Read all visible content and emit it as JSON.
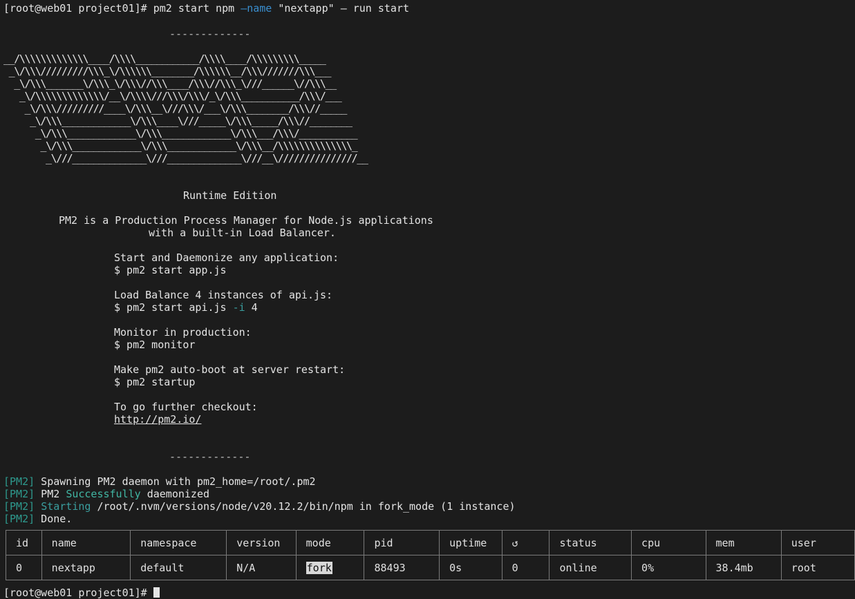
{
  "terminal": {
    "prompt": "[root@web01 project01]# ",
    "command": {
      "part1": "pm2 start npm ",
      "flag": "—name",
      "part2": " \"nextapp\" ",
      "part3": "— run start"
    },
    "separator": "-------------",
    "ascii_art": [
      "__/\\\\\\\\\\\\\\\\\\\\\\\\\\____/\\\\\\\\____________/\\\\\\\\____/\\\\\\\\\\\\\\\\\\_____",
      " _\\/\\\\\\/////////\\\\\\_\\/\\\\\\\\\\\\________/\\\\\\\\\\\\__/\\\\\\///////\\\\\\___",
      "  _\\/\\\\\\_______\\/\\\\\\_\\/\\\\\\//\\\\\\____/\\\\\\//\\\\\\_\\///______\\//\\\\\\__",
      "   _\\/\\\\\\\\\\\\\\\\\\\\\\\\\\/__\\/\\\\\\\\///\\\\\\/\\\\\\/_\\/\\\\\\___________/\\\\\\/___",
      "    _\\/\\\\\\/////////____\\/\\\\\\__\\///\\\\\\/___\\/\\\\\\________/\\\\\\//_____",
      "     _\\/\\\\\\_____________\\/\\\\\\____\\///_____\\/\\\\\\_____/\\\\\\//________",
      "      _\\/\\\\\\_____________\\/\\\\\\_____________\\/\\\\\\___/\\\\\\/___________",
      "       _\\/\\\\\\_____________\\/\\\\\\_____________\\/\\\\\\__/\\\\\\\\\\\\\\\\\\\\\\\\\\\\_",
      "        _\\///______________\\///______________\\///__\\///////////////__"
    ],
    "edition": "Runtime Edition",
    "intro_1": "PM2 is a Production Process Manager for Node.js applications",
    "intro_2": "with a built-in Load Balancer.",
    "tips": [
      {
        "title": "Start and Daemonize any application:",
        "cmd": "$ pm2 start app.js"
      },
      {
        "title": "Load Balance 4 instances of api.js:",
        "cmd_a": "$ pm2 start api.js ",
        "cmd_flag": "-i",
        "cmd_b": " 4"
      },
      {
        "title": "Monitor in production:",
        "cmd": "$ pm2 monitor"
      },
      {
        "title": "Make pm2 auto-boot at server restart:",
        "cmd": "$ pm2 startup"
      },
      {
        "title": "To go further checkout:",
        "cmd": "http://pm2.io/"
      }
    ],
    "log_tag": "[PM2]",
    "logs": [
      {
        "text": " Spawning PM2 daemon with pm2_home=/root/.pm2"
      },
      {
        "pre": " PM2 ",
        "accent": "Successfully",
        "post": " daemonized"
      },
      {
        "pre": " ",
        "accent": "Starting",
        "post": " /root/.nvm/versions/node/v20.12.2/bin/npm in fork_mode (1 instance)"
      },
      {
        "text": " Done."
      }
    ],
    "table": {
      "headers": [
        "id",
        "name",
        "namespace",
        "version",
        "mode",
        "pid",
        "uptime",
        "↺",
        "status",
        "cpu",
        "mem",
        "user"
      ],
      "row": {
        "id": "0",
        "name": "nextapp",
        "namespace": "default",
        "version": "N/A",
        "mode": "fork",
        "pid": "88493",
        "uptime": "0s",
        "restarts": "0",
        "status": "online",
        "cpu": "0%",
        "mem": "38.4mb",
        "user": "root"
      }
    },
    "final_prompt": "[root@web01 project01]# "
  },
  "colors": {
    "background": "#1c1c1c",
    "text": "#e4e4e4",
    "flag_blue": "#3a8fd0",
    "pm2_tag": "#2e9a8e",
    "status_online": "#41b6a3"
  }
}
